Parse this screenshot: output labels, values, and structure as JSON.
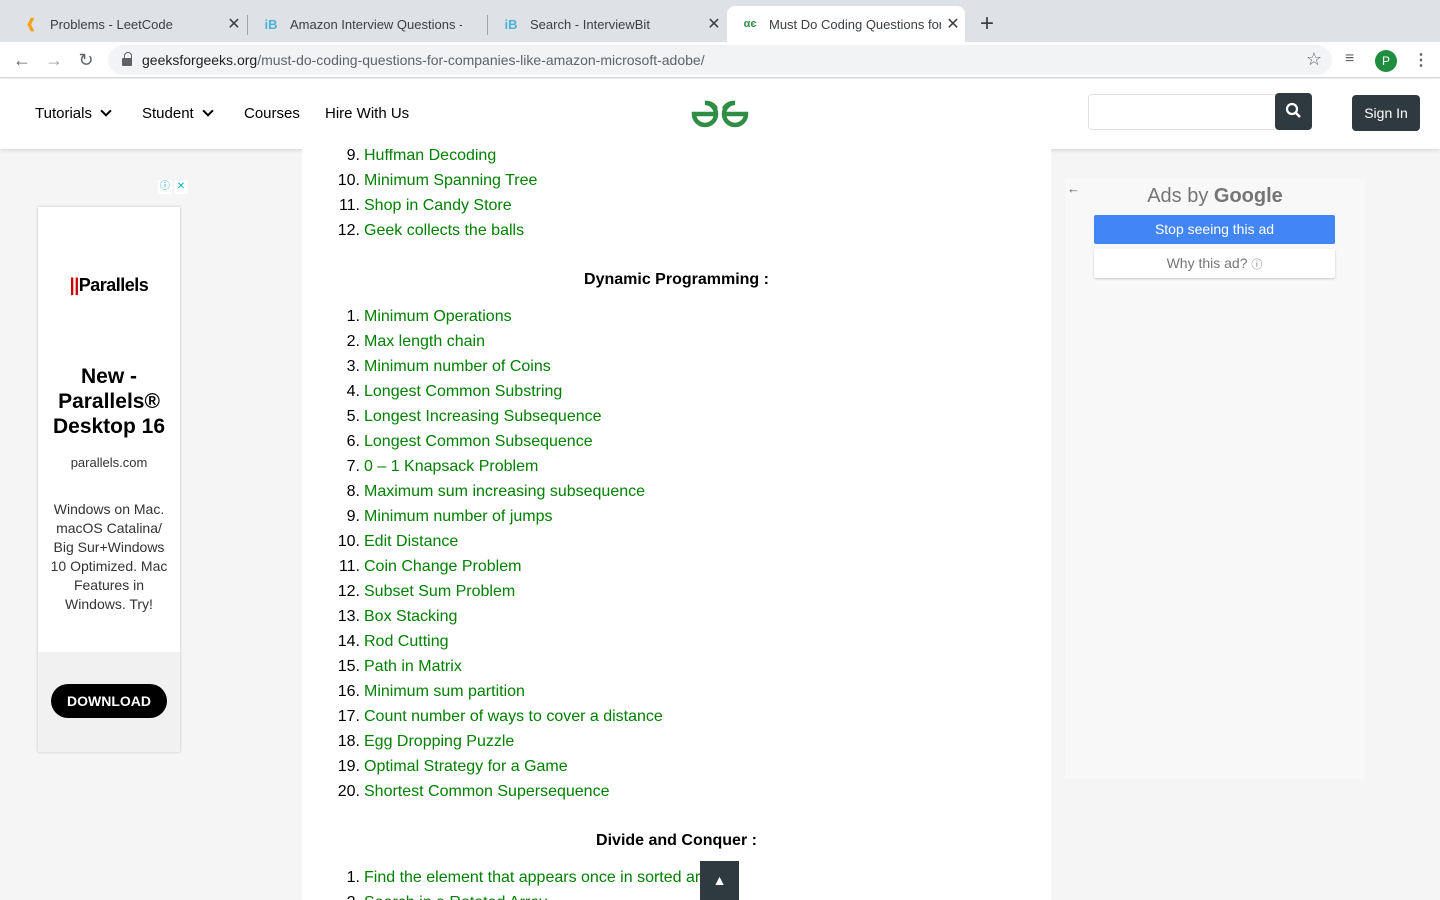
{
  "browser": {
    "tabs": [
      {
        "title": "Problems - LeetCode",
        "favicon": "leetcode-icon"
      },
      {
        "title": "Amazon Interview Questions - ",
        "favicon": "interviewbit-icon"
      },
      {
        "title": "Search - InterviewBit",
        "favicon": "interviewbit-icon"
      },
      {
        "title": "Must Do Coding Questions for ",
        "favicon": "gfg-icon"
      }
    ],
    "url_host": "geeksforgeeks.org",
    "url_path": "/must-do-coding-questions-for-companies-like-amazon-microsoft-adobe/",
    "profile_initial": "P"
  },
  "site_nav": {
    "tutorials": "Tutorials",
    "student": "Student",
    "courses": "Courses",
    "hire": "Hire With Us",
    "sign_in": "Sign In"
  },
  "left_ad": {
    "brand": "Parallels",
    "headline": "New - Parallels® Desktop 16",
    "domain": "parallels.com",
    "description": "Windows on Mac. macOS Catalina/ Big Sur+Windows 10 Optimized. Mac Features in Windows. Try!",
    "cta": "DOWNLOAD"
  },
  "right_ad": {
    "ads_by": "Ads by",
    "google": "Google",
    "stop": "Stop seeing this ad",
    "why": "Why this ad?"
  },
  "greedy_tail": [
    {
      "n": "9.",
      "t": "Huffman Decoding"
    },
    {
      "n": "10.",
      "t": "Minimum Spanning Tree"
    },
    {
      "n": "11.",
      "t": "Shop in Candy Store"
    },
    {
      "n": "12.",
      "t": "Geek collects the balls"
    }
  ],
  "dp_heading": "Dynamic Programming :",
  "dp": [
    {
      "n": "1.",
      "t": "Minimum Operations"
    },
    {
      "n": "2.",
      "t": "Max length chain"
    },
    {
      "n": "3.",
      "t": "Minimum number of Coins"
    },
    {
      "n": "4.",
      "t": "Longest Common Substring"
    },
    {
      "n": "5.",
      "t": "Longest Increasing Subsequence"
    },
    {
      "n": "6.",
      "t": "Longest Common Subsequence"
    },
    {
      "n": "7.",
      "t": "0 – 1 Knapsack Problem"
    },
    {
      "n": "8.",
      "t": "Maximum sum increasing subsequence"
    },
    {
      "n": "9.",
      "t": "Minimum number of jumps"
    },
    {
      "n": "10.",
      "t": "Edit Distance"
    },
    {
      "n": "11.",
      "t": "Coin Change Problem"
    },
    {
      "n": "12.",
      "t": "Subset Sum Problem"
    },
    {
      "n": "13.",
      "t": "Box Stacking"
    },
    {
      "n": "14.",
      "t": "Rod Cutting"
    },
    {
      "n": "15.",
      "t": "Path in Matrix"
    },
    {
      "n": "16.",
      "t": "Minimum sum partition"
    },
    {
      "n": "17.",
      "t": "Count number of ways to cover a distance"
    },
    {
      "n": "18.",
      "t": "Egg Dropping Puzzle"
    },
    {
      "n": "19.",
      "t": "Optimal Strategy for a Game"
    },
    {
      "n": "20.",
      "t": "Shortest Common Supersequence"
    }
  ],
  "dc_heading": "Divide and Conquer :",
  "dc": [
    {
      "n": "1.",
      "t": "Find the element that appears once in sorted array"
    },
    {
      "n": "2.",
      "t": "Search in a Rotated Array"
    }
  ]
}
